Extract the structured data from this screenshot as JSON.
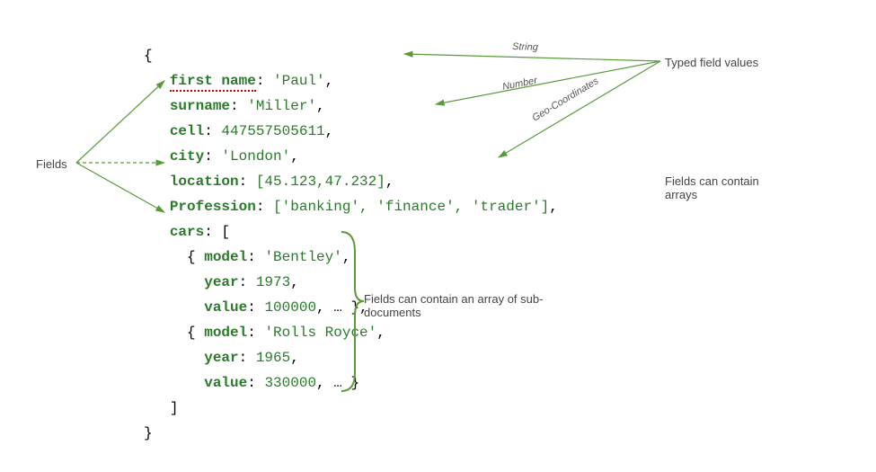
{
  "labels": {
    "fields": "Fields",
    "typed": "Typed field values",
    "arrays": "Fields can contain arrays",
    "subdocs": "Fields can contain an array of sub-documents",
    "typeString": "String",
    "typeNumber": "Number",
    "typeGeo": "Geo-Coordinates"
  },
  "doc": {
    "open": "{",
    "indent": "   ",
    "k1": "first name",
    "v1": "'Paul'",
    "k2": "surname",
    "v2": "'Miller'",
    "k3": "cell",
    "v3": "447557505611",
    "k4": "city",
    "v4": "'London'",
    "k5": "location",
    "v5": "[45.123,47.232]",
    "k6": "Profession",
    "v6": "['banking', 'finance', 'trader']",
    "k7": "cars",
    "carsOpen": "[",
    "carOpen": "{ ",
    "ck1": "model",
    "cv1a": "'Bentley'",
    "ck2": "year",
    "cv2a": "1973",
    "ck3": "value",
    "cv3a": "100000",
    "carCloseA": ", … },",
    "cv1b": "'Rolls Royce'",
    "cv2b": "1965",
    "cv3b": "330000",
    "carCloseB": ", … }",
    "carsClose": "]",
    "close": "}"
  }
}
